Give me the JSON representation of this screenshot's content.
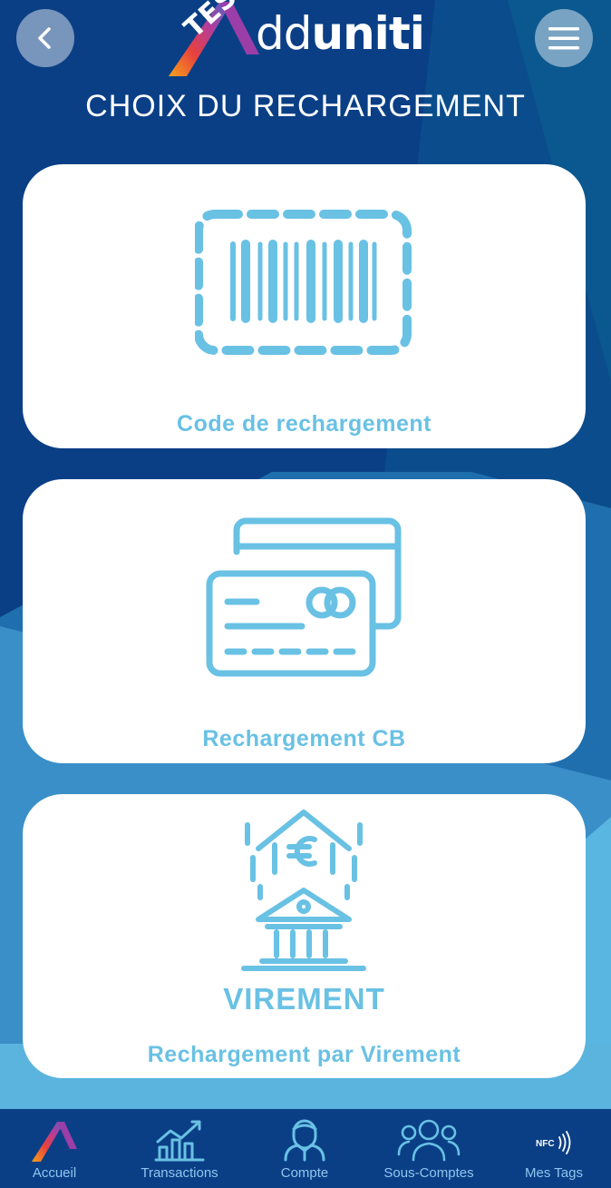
{
  "header": {
    "logo_main_light": "dd",
    "logo_main_bold": "uniti",
    "logo_stamp": "TEST",
    "back_icon": "chevron-left-icon",
    "menu_icon": "hamburger-menu-icon"
  },
  "page": {
    "title": "CHOIX DU RECHARGEMENT"
  },
  "options": [
    {
      "label": "Code de rechargement",
      "icon": "barcode-icon"
    },
    {
      "label": "Rechargement CB",
      "icon": "credit-card-icon"
    },
    {
      "label": "Rechargement par Virement",
      "icon": "bank-transfer-icon",
      "icon_caption": "VIREMENT"
    }
  ],
  "bottom_nav": [
    {
      "label": "Accueil",
      "icon": "home-logo-icon"
    },
    {
      "label": "Transactions",
      "icon": "chart-icon"
    },
    {
      "label": "Compte",
      "icon": "user-icon"
    },
    {
      "label": "Sous-Comptes",
      "icon": "group-icon"
    },
    {
      "label": "Mes Tags",
      "icon": "nfc-icon",
      "icon_text": "NFC"
    }
  ],
  "colors": {
    "accent": "#69c1e4",
    "background": "#0a3f86",
    "nav_label": "#8cc8ef"
  }
}
